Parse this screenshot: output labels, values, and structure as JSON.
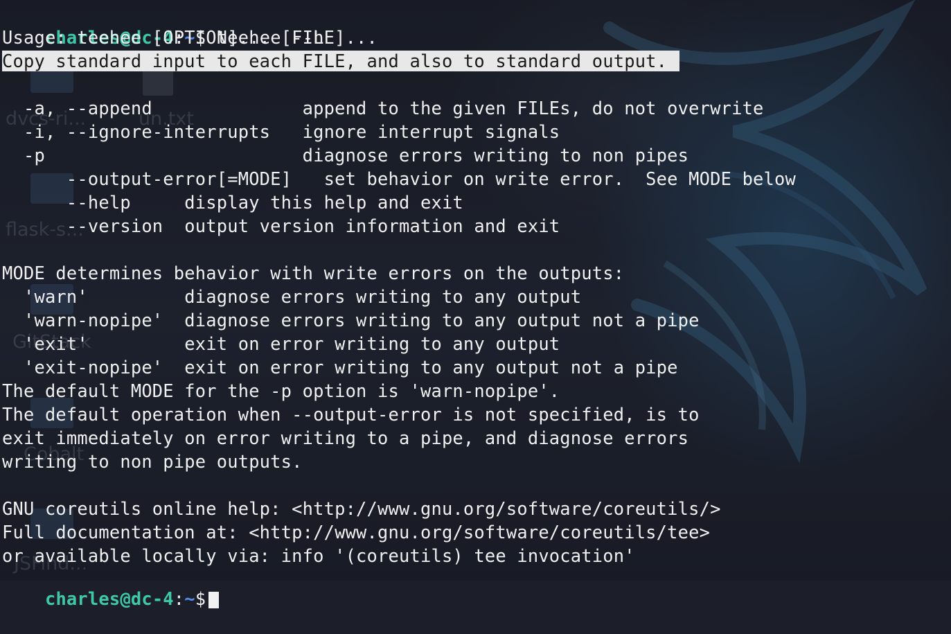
{
  "prompt": {
    "user_host": "charles@dc-4",
    "colon": ":",
    "path": "~",
    "symbol": "$"
  },
  "command": "teehee --h",
  "output_lines": [
    "Usage: teehee [OPTION]... [FILE]...",
    "Copy standard input to each FILE, and also to standard output.",
    "",
    "  -a, --append              append to the given FILEs, do not overwrite",
    "  -i, --ignore-interrupts   ignore interrupt signals",
    "  -p                        diagnose errors writing to non pipes",
    "      --output-error[=MODE]   set behavior on write error.  See MODE below",
    "      --help     display this help and exit",
    "      --version  output version information and exit",
    "",
    "MODE determines behavior with write errors on the outputs:",
    "  'warn'         diagnose errors writing to any output",
    "  'warn-nopipe'  diagnose errors writing to any output not a pipe",
    "  'exit'         exit on error writing to any output",
    "  'exit-nopipe'  exit on error writing to any output not a pipe",
    "The default MODE for the -p option is 'warn-nopipe'.",
    "The default operation when --output-error is not specified, is to",
    "exit immediately on error writing to a pipe, and diagnose errors",
    "writing to non pipe outputs.",
    "",
    "GNU coreutils online help: <http://www.gnu.org/software/coreutils/>",
    "Full documentation at: <http://www.gnu.org/software/coreutils/tee>",
    "or available locally via: info '(coreutils) tee invocation'"
  ],
  "desktop_icons": {
    "dvcs": "dvcs-ri...",
    "untxt": "un.txt",
    "flask": "flask-s...",
    "gitstack": "GitStack",
    "cobalt": "Cobalt",
    "jsfind": "JSFind..."
  },
  "colors": {
    "prompt_user": "#3fc8a8",
    "prompt_path": "#5a8dee",
    "text": "#f0f0f0",
    "selection_bg": "#e8e8e8"
  }
}
